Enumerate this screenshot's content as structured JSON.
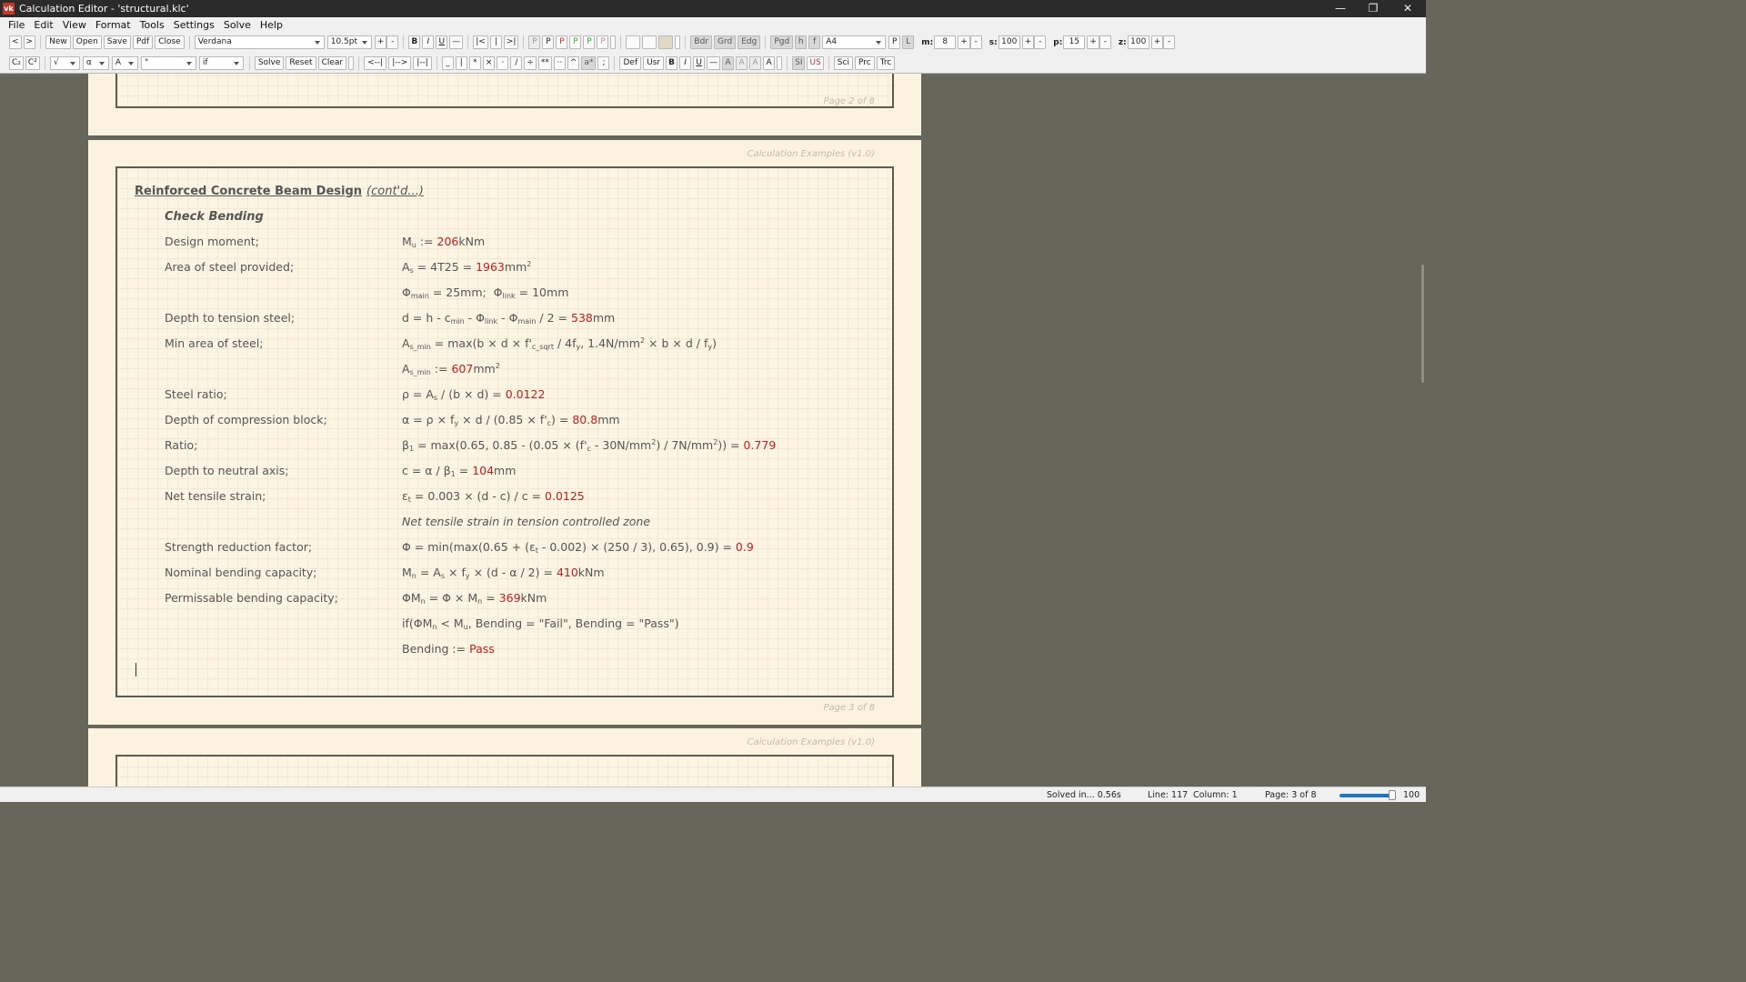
{
  "window": {
    "icon": "vk",
    "title": "Calculation Editor  -  'structural.klc'",
    "minimize": "—",
    "maximize": "❐",
    "close": "✕"
  },
  "menu": [
    "File",
    "Edit",
    "View",
    "Format",
    "Tools",
    "Settings",
    "Solve",
    "Help"
  ],
  "toolbar1": {
    "nav_back": "<",
    "nav_fwd": ">",
    "new": "New",
    "open": "Open",
    "save": "Save",
    "pdf": "Pdf",
    "close": "Close",
    "font": "Verdana",
    "size": "10.5pt",
    "size_inc": "+",
    "size_dec": "-",
    "bold": "B",
    "italic": "I",
    "underline": "U",
    "strike": "—",
    "align_left": "|<",
    "align_center": "|",
    "align_right": ">|",
    "p_buttons": [
      "P",
      "P",
      "P",
      "P",
      "P",
      "P"
    ],
    "bdr": "Bdr",
    "grd": "Grd",
    "edg": "Edg",
    "pgd": "Pgd",
    "h": "h",
    "f": "f",
    "paper": "A4",
    "portrait": "P",
    "landscape": "L",
    "m_label": "m:",
    "m_value": "8",
    "s_label": "s:",
    "s_value": "100",
    "p_label": "p:",
    "p_value": "15",
    "z_label": "z:",
    "z_value": "100",
    "plus": "+",
    "minus": "-"
  },
  "toolbar2": {
    "subscript": "C₂",
    "superscript": "C²",
    "sqrt_combo": "√",
    "greek_combo": "α",
    "letter_combo": "A",
    "degree_combo": "°",
    "if_combo": "if",
    "solve": "Solve",
    "reset": "Reset",
    "clear": "Clear",
    "indent_left": "<--|",
    "indent_right": "|-->",
    "indent_none": "|--|",
    "ops": [
      "_",
      "|",
      "*",
      "×",
      "·",
      "/",
      "÷",
      "**",
      "··",
      "^",
      "a*",
      ";"
    ],
    "def": "Def",
    "usr": "Usr",
    "bold": "B",
    "italic": "I",
    "underline": "U",
    "strike": "—",
    "color_a": [
      "A",
      "A",
      "A",
      "A"
    ],
    "si": "SI",
    "us": "US",
    "sci": "Sci",
    "prc": "Prc",
    "trc": "Trc"
  },
  "pages": {
    "prev_footer": "Page 2 of 8",
    "header": "Calculation Examples (v1.0)",
    "footer": "Page 3 of 8",
    "next_header": "Calculation Examples (v1.0)"
  },
  "doc": {
    "title": "Reinforced Concrete Beam Design",
    "cont": "(cont'd...)",
    "section": "Check Bending",
    "rows": [
      {
        "desc": "Design moment;"
      },
      {
        "desc": "Area of steel provided;"
      },
      {
        "desc": ""
      },
      {
        "desc": "Depth to tension steel;"
      },
      {
        "desc": "Min area of steel;"
      },
      {
        "desc": ""
      },
      {
        "desc": "Steel ratio;"
      },
      {
        "desc": "Depth of compression block;"
      },
      {
        "desc": "Ratio;"
      },
      {
        "desc": "Depth to neutral axis;"
      },
      {
        "desc": "Net tensile strain;"
      },
      {
        "desc": ""
      },
      {
        "desc": "Strength reduction factor;"
      },
      {
        "desc": "Nominal bending capacity;"
      },
      {
        "desc": "Permissable bending capacity;"
      },
      {
        "desc": ""
      },
      {
        "desc": ""
      }
    ],
    "values": {
      "mu": "206",
      "as": "1963",
      "d": "538",
      "asmin": "607",
      "rho": "0.0122",
      "a": "80.8",
      "beta": "0.779",
      "c": "104",
      "eps": "0.0125",
      "phi": "0.9",
      "mn": "410",
      "phimn": "369",
      "bending": "Pass"
    },
    "note": "Net tensile strain in tension controlled zone"
  },
  "status": {
    "solved": "Solved in... 0.56s",
    "line": "Line: 117",
    "column": "Column: 1",
    "page": "Page: 3 of 8",
    "zoom": "100"
  }
}
